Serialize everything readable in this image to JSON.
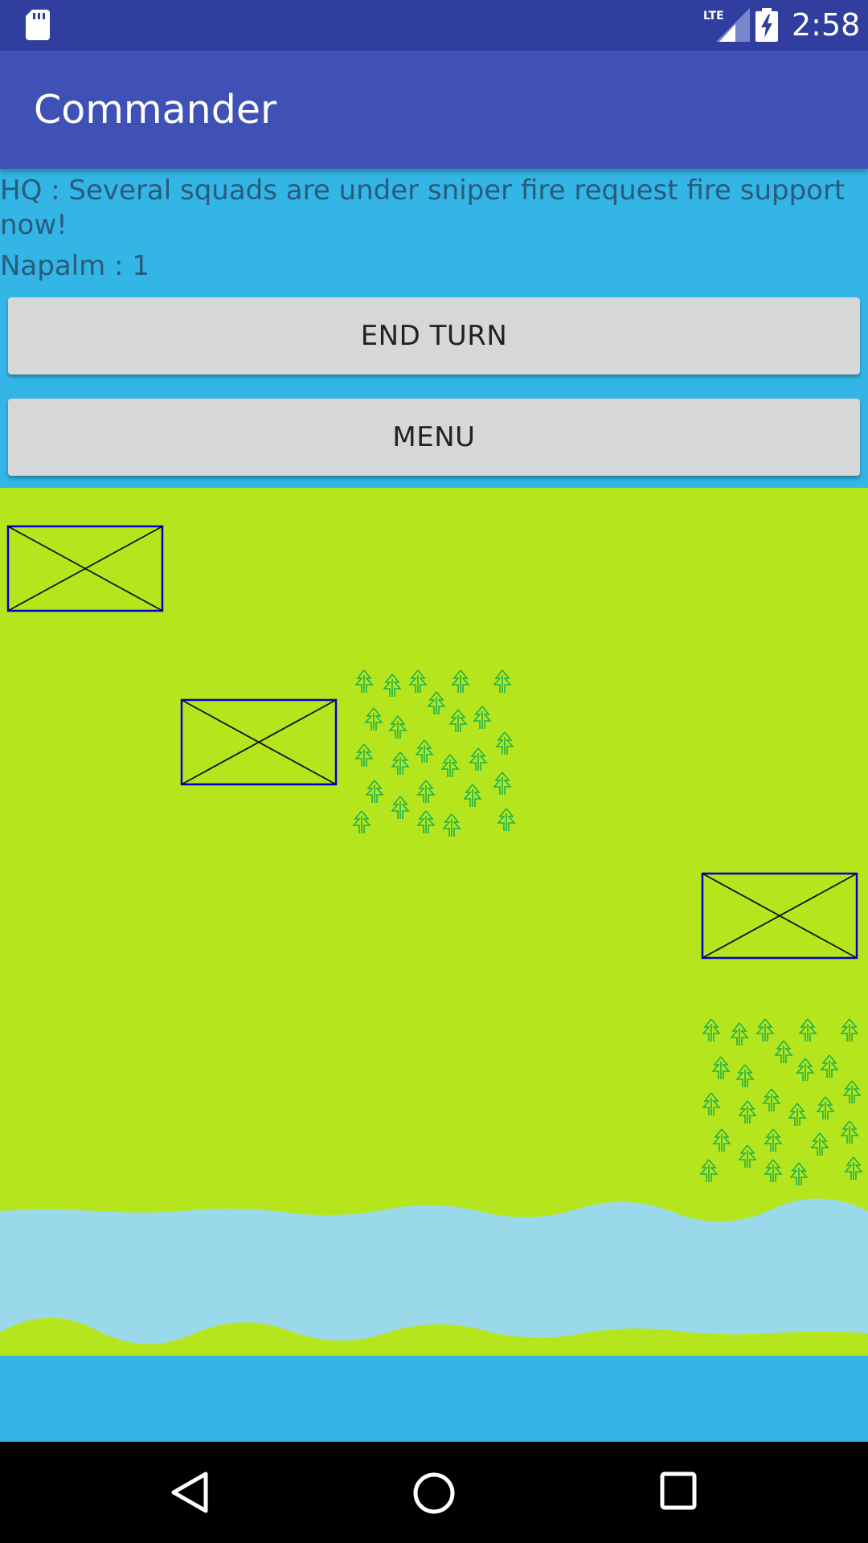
{
  "status_bar": {
    "time": "2:58",
    "network_label": "LTE",
    "icons": [
      "sd-card-icon",
      "lte-signal-icon",
      "battery-charging-icon"
    ]
  },
  "app_bar": {
    "title": "Commander"
  },
  "game": {
    "hq_message": "HQ : Several squads are under sniper fire request fire support now!",
    "napalm_text": "Napalm : 1",
    "end_turn_label": "END TURN",
    "menu_label": "MENU",
    "map": {
      "units": [
        "enemy-unit",
        "enemy-unit",
        "enemy-unit"
      ],
      "terrain": [
        "forest",
        "forest",
        "river"
      ]
    }
  },
  "nav_bar": {
    "icons": [
      "back-icon",
      "home-icon",
      "recents-icon"
    ]
  },
  "colors": {
    "status_bar": "#303f9f",
    "app_bar": "#3f51b5",
    "background": "#33b5e5",
    "grass": "#b5e61d",
    "water": "#99d9ea",
    "unit_border": "#0000cc",
    "tree": "#22b14c"
  }
}
